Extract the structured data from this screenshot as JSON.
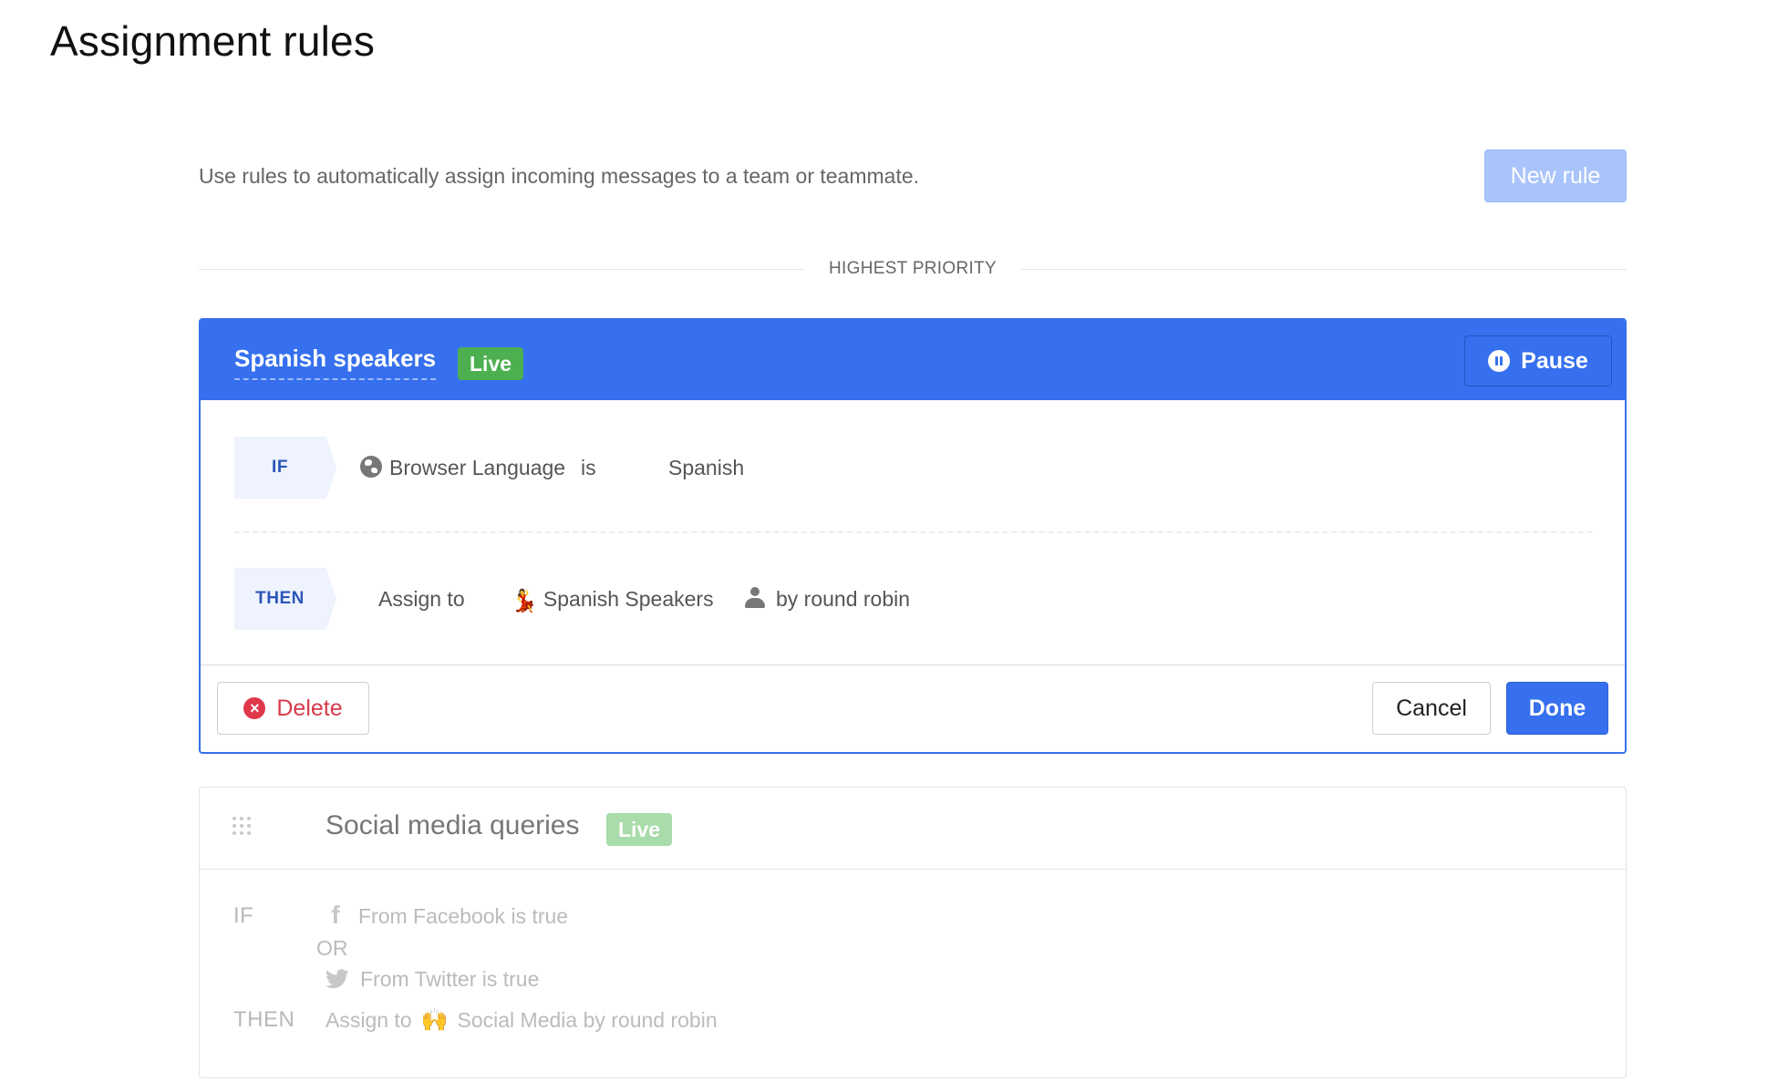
{
  "page": {
    "title": "Assignment rules"
  },
  "intro": {
    "text": "Use rules to automatically assign incoming messages to a team or teammate.",
    "new_rule_label": "New rule"
  },
  "priority_label": "HIGHEST PRIORITY",
  "active_rule": {
    "name": "Spanish speakers",
    "status": "Live",
    "pause_label": "Pause",
    "if_label": "IF",
    "condition": {
      "attribute": "Browser Language",
      "operator": "is",
      "value": "Spanish"
    },
    "then_label": "THEN",
    "action": {
      "prefix": "Assign to",
      "team": "Spanish Speakers",
      "method": "by round robin"
    },
    "delete_label": "Delete",
    "cancel_label": "Cancel",
    "done_label": "Done"
  },
  "second_rule": {
    "name": "Social media queries",
    "status": "Live",
    "if_label": "IF",
    "conditions": [
      "From Facebook is true",
      "From Twitter is true"
    ],
    "or_label": "OR",
    "then_label": "THEN",
    "action_prefix": "Assign to",
    "action_text": "Social Media by round robin"
  },
  "icons": {
    "globe": "globe-icon",
    "dancer": "dancer-emoji-icon",
    "person": "person-icon",
    "pause": "pause-circle-icon",
    "delete": "x-circle-icon",
    "facebook": "facebook-icon",
    "twitter": "twitter-icon",
    "hands": "raised-hands-emoji-icon",
    "drag": "drag-handle-icon"
  },
  "colors": {
    "primary": "#3670ee",
    "live": "#4caf50",
    "live_faded": "#a8dcab",
    "danger": "#e0384b",
    "new_rule_disabled": "#a9c4fb"
  }
}
